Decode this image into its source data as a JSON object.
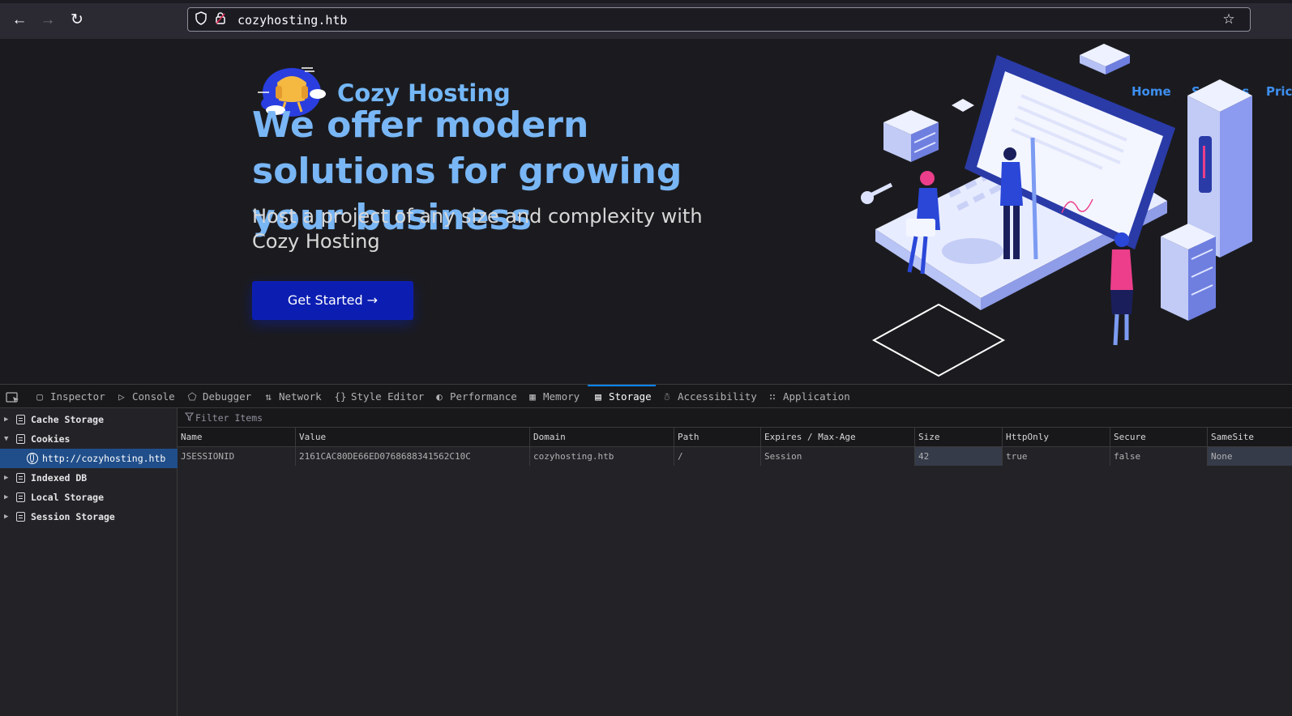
{
  "browser": {
    "url": "cozyhosting.htb",
    "back_icon": "arrow-left",
    "forward_icon": "arrow-right",
    "reload_icon": "reload",
    "shield_icon": "shield",
    "lock_icon": "lock-warning",
    "bookmark_icon": "star"
  },
  "site": {
    "brand": "Cozy Hosting",
    "nav": [
      "Home",
      "Services",
      "Pricin"
    ],
    "hero_title": "We offer modern solutions for growing your business",
    "hero_subtitle": "Host a project of any size and complexity with Cozy Hosting",
    "cta_label": "Get Started →"
  },
  "devtools": {
    "tabs": [
      {
        "label": "Inspector",
        "icon": "inspector-icon"
      },
      {
        "label": "Console",
        "icon": "console-icon"
      },
      {
        "label": "Debugger",
        "icon": "debugger-icon"
      },
      {
        "label": "Network",
        "icon": "network-icon"
      },
      {
        "label": "Style Editor",
        "icon": "style-editor-icon"
      },
      {
        "label": "Performance",
        "icon": "performance-icon"
      },
      {
        "label": "Memory",
        "icon": "memory-icon"
      },
      {
        "label": "Storage",
        "icon": "storage-icon"
      },
      {
        "label": "Accessibility",
        "icon": "accessibility-icon"
      },
      {
        "label": "Application",
        "icon": "application-icon"
      }
    ],
    "active_tab": "Storage",
    "sidebar": {
      "items": [
        {
          "label": "Cache Storage"
        },
        {
          "label": "Cookies"
        },
        {
          "label": "http://cozyhosting.htb"
        },
        {
          "label": "Indexed DB"
        },
        {
          "label": "Local Storage"
        },
        {
          "label": "Session Storage"
        }
      ]
    },
    "filter_placeholder": "Filter Items",
    "table": {
      "columns": [
        "Name",
        "Value",
        "Domain",
        "Path",
        "Expires / Max-Age",
        "Size",
        "HttpOnly",
        "Secure",
        "SameSite"
      ],
      "rows": [
        {
          "cells": [
            "JSESSIONID",
            "2161CAC80DE66ED0768688341562C10C",
            "cozyhosting.htb",
            "/",
            "Session",
            "42",
            "true",
            "false",
            "None"
          ]
        }
      ]
    }
  }
}
